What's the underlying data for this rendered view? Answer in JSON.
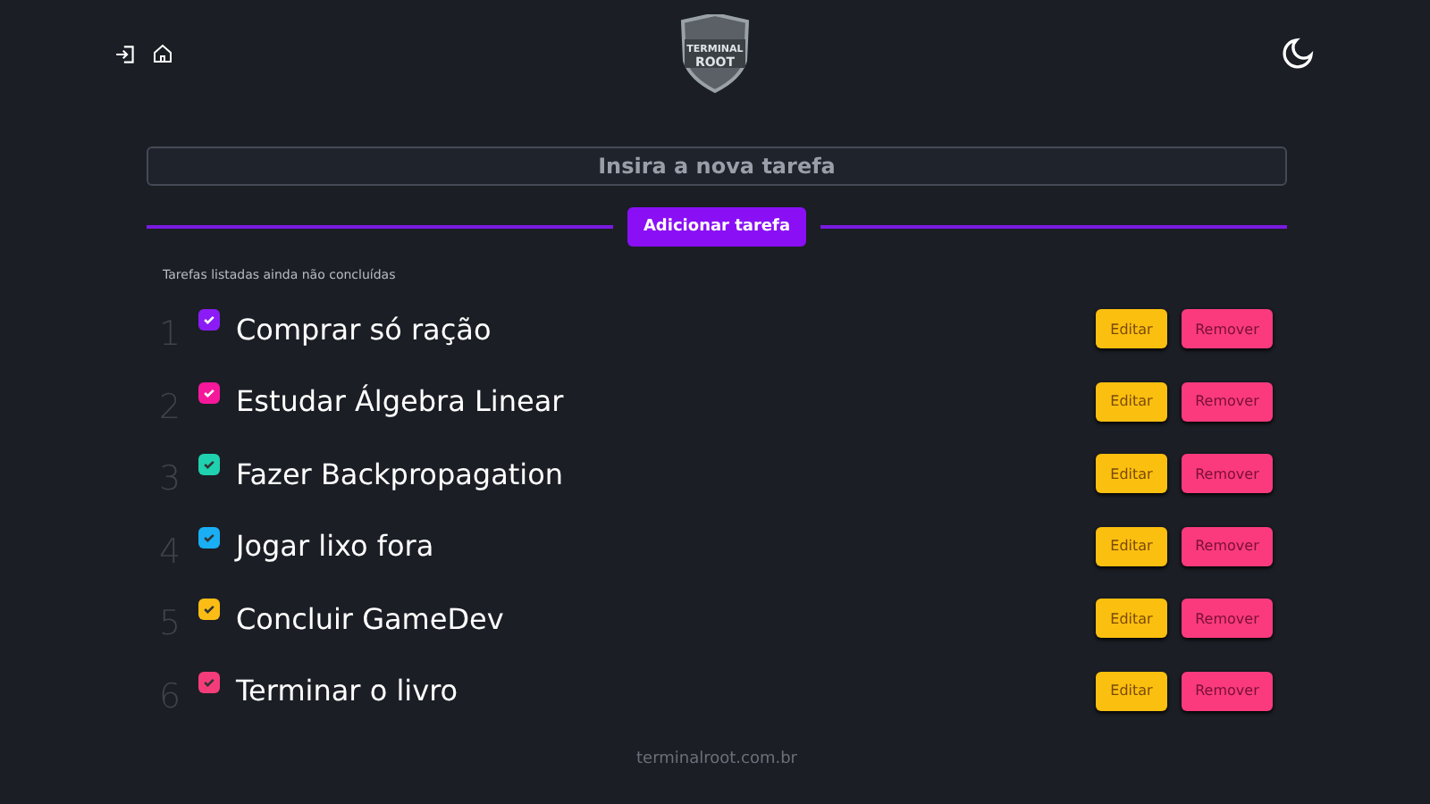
{
  "logo": {
    "line_1": "TERMINAL",
    "line_2": "ROOT"
  },
  "task_input": {
    "placeholder": "Insira a nova tarefa"
  },
  "add_button": "Adicionar tarefa",
  "list_caption": "Tarefas listadas ainda não concluídas",
  "tasks": [
    {
      "number": "1",
      "title": "Comprar só ração",
      "checked": true,
      "color": "#8b1cf5",
      "edit": "Editar",
      "remove": "Remover"
    },
    {
      "number": "2",
      "title": "Estudar Álgebra Linear",
      "checked": true,
      "color": "#f5189a",
      "edit": "Editar",
      "remove": "Remover"
    },
    {
      "number": "3",
      "title": "Fazer Backpropagation",
      "checked": true,
      "color": "#1fd1ae",
      "edit": "Editar",
      "remove": "Remover"
    },
    {
      "number": "4",
      "title": "Jogar lixo fora",
      "checked": true,
      "color": "#1aaef5",
      "edit": "Editar",
      "remove": "Remover"
    },
    {
      "number": "5",
      "title": "Concluir GameDev",
      "checked": true,
      "color": "#fbbd15",
      "edit": "Editar",
      "remove": "Remover"
    },
    {
      "number": "6",
      "title": "Terminar o livro",
      "checked": true,
      "color": "#f53c7a",
      "edit": "Editar",
      "remove": "Remover"
    }
  ],
  "footer": "terminalroot.com.br"
}
